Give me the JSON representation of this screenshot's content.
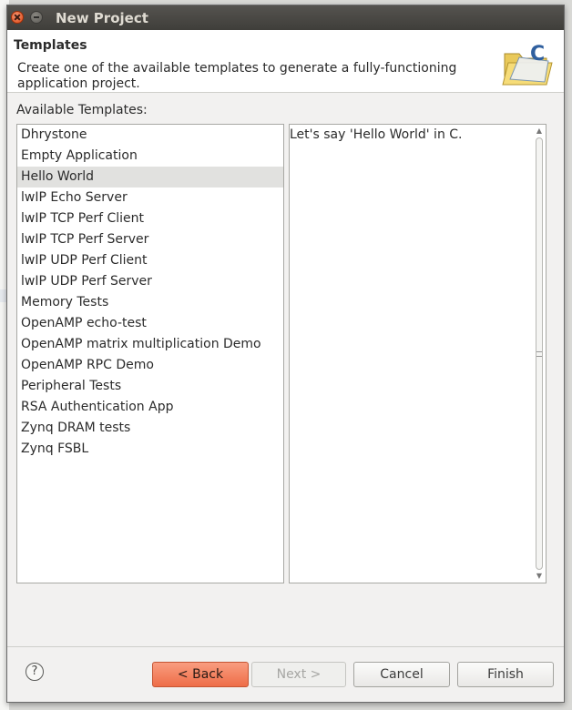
{
  "window": {
    "title": "New Project"
  },
  "header": {
    "title": "Templates",
    "description": "Create one of the available templates to generate a fully-functioning application project.",
    "icon_letter": "C"
  },
  "templates": {
    "label": "Available Templates:",
    "selected": "Hello World",
    "items": [
      "Dhrystone",
      "Empty Application",
      "Hello World",
      "lwIP Echo Server",
      "lwIP TCP Perf Client",
      "lwIP TCP Perf Server",
      "lwIP UDP Perf Client",
      "lwIP UDP Perf Server",
      "Memory Tests",
      "OpenAMP echo-test",
      "OpenAMP matrix multiplication Demo",
      "OpenAMP RPC Demo",
      "Peripheral Tests",
      "RSA Authentication App",
      "Zynq DRAM tests",
      "Zynq FSBL"
    ]
  },
  "description_pane": {
    "text": "Let's say 'Hello World' in C."
  },
  "buttons": {
    "help": "?",
    "back": "< Back",
    "next": "Next >",
    "cancel": "Cancel",
    "finish": "Finish"
  },
  "colors": {
    "accent": "#ee6d48",
    "titlebar": "#46443f",
    "selection": "#e1e1df"
  }
}
